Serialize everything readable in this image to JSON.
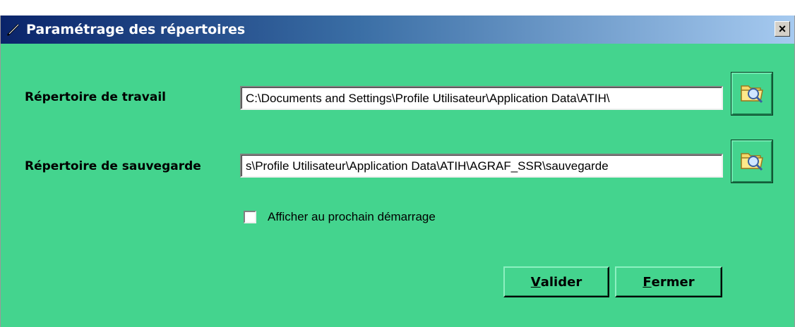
{
  "window": {
    "title": "Paramétrage des répertoires",
    "close_label": "×"
  },
  "work_dir": {
    "label": "Répertoire de travail",
    "value": "C:\\Documents and Settings\\Profile Utilisateur\\Application Data\\ATIH\\",
    "browse_icon": "folder-search-icon"
  },
  "backup_dir": {
    "label": "Répertoire de sauvegarde",
    "value": "s\\Profile Utilisateur\\Application Data\\ATIH\\AGRAF_SSR\\sauvegarde",
    "browse_icon": "folder-search-icon"
  },
  "startup": {
    "label": "Afficher au prochain démarrage",
    "checked": false
  },
  "buttons": {
    "validate_first": "V",
    "validate_rest": "alider",
    "close_first": "F",
    "close_rest": "ermer"
  },
  "colors": {
    "background": "#44d48e",
    "titlebar_start": "#0a246a",
    "titlebar_end": "#a6caf0"
  }
}
